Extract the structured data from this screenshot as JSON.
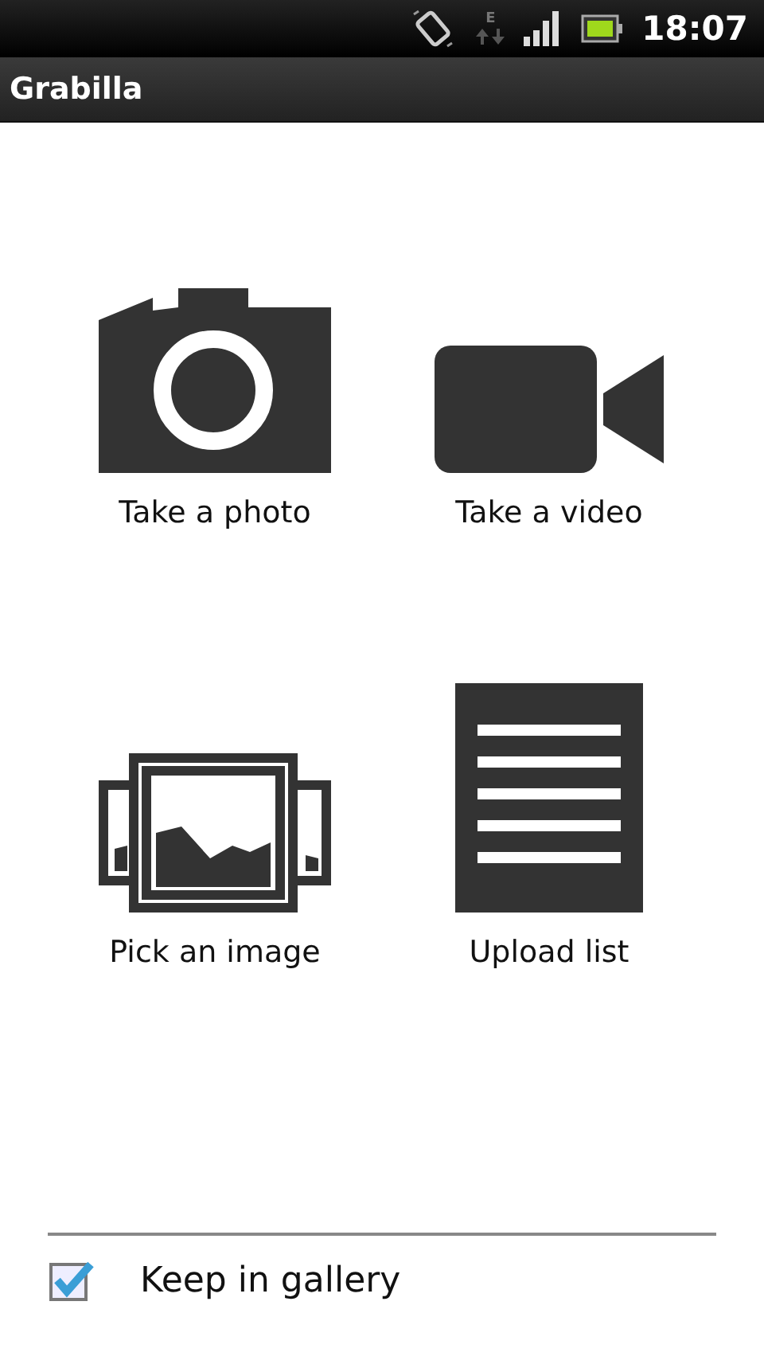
{
  "status_bar": {
    "network_type": "E",
    "time": "18:07"
  },
  "title_bar": {
    "title": "Grabilla"
  },
  "actions": [
    {
      "kind": "camera",
      "label": "Take a photo"
    },
    {
      "kind": "video",
      "label": "Take a video"
    },
    {
      "kind": "gallery",
      "label": "Pick an image"
    },
    {
      "kind": "list",
      "label": "Upload list"
    }
  ],
  "keep_in_gallery": {
    "label": "Keep in gallery",
    "checked": true
  }
}
